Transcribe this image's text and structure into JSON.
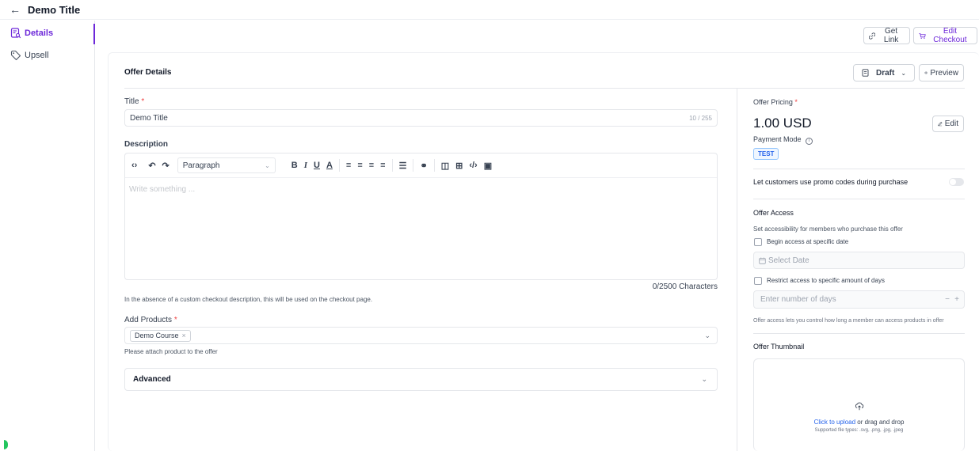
{
  "topbar": {
    "back_icon": "arrow-left-icon",
    "title": "Demo Title"
  },
  "sidebar": {
    "items": [
      {
        "label": "Details",
        "icon": "document-search-icon",
        "active": true
      },
      {
        "label": "Upsell",
        "icon": "tag-icon",
        "active": false
      }
    ]
  },
  "header_actions": {
    "get_link": "Get Link",
    "edit_checkout": "Edit Checkout"
  },
  "offer": {
    "heading": "Offer Details",
    "status": "Draft",
    "preview": "Preview",
    "title_label": "Title",
    "title_value": "Demo Title",
    "title_counter": "10 / 255",
    "description_label": "Description",
    "editor": {
      "paragraph": "Paragraph",
      "placeholder": "Write something ...",
      "counter": "0/2500 Characters",
      "tools": {
        "bold": "B",
        "italic": "I",
        "underline": "U",
        "color": "A"
      }
    },
    "description_hint": "In the absence of a custom checkout description, this will be used on the checkout page.",
    "products_label": "Add Products",
    "products": [
      "Demo Course"
    ],
    "products_hint": "Please attach product to the offer",
    "advanced": "Advanced"
  },
  "pricing": {
    "label": "Offer Pricing",
    "amount": "1.00 USD",
    "edit": "Edit",
    "payment_mode_label": "Payment Mode",
    "payment_mode": "TEST",
    "promo_label": "Let customers use promo codes during purchase",
    "promo_enabled": false
  },
  "access": {
    "heading": "Offer Access",
    "subtext": "Set accessibility for members who purchase this offer",
    "begin_label": "Begin access at specific date",
    "date_placeholder": "Select Date",
    "restrict_label": "Restrict access to specific amount of days",
    "days_placeholder": "Enter number of days",
    "stepper": {
      "minus": "−",
      "plus": "+"
    },
    "footer": "Offer access lets you control how long a member can access products in offer"
  },
  "thumbnail": {
    "heading": "Offer Thumbnail",
    "upload_link": "Click to upload",
    "upload_rest": " or drag and drop",
    "supported": "Supported file types: .svg, .png, .jpg, .jpeg"
  },
  "colors": {
    "accent": "#6d28d9",
    "link": "#2563eb",
    "required": "#ef4444"
  }
}
